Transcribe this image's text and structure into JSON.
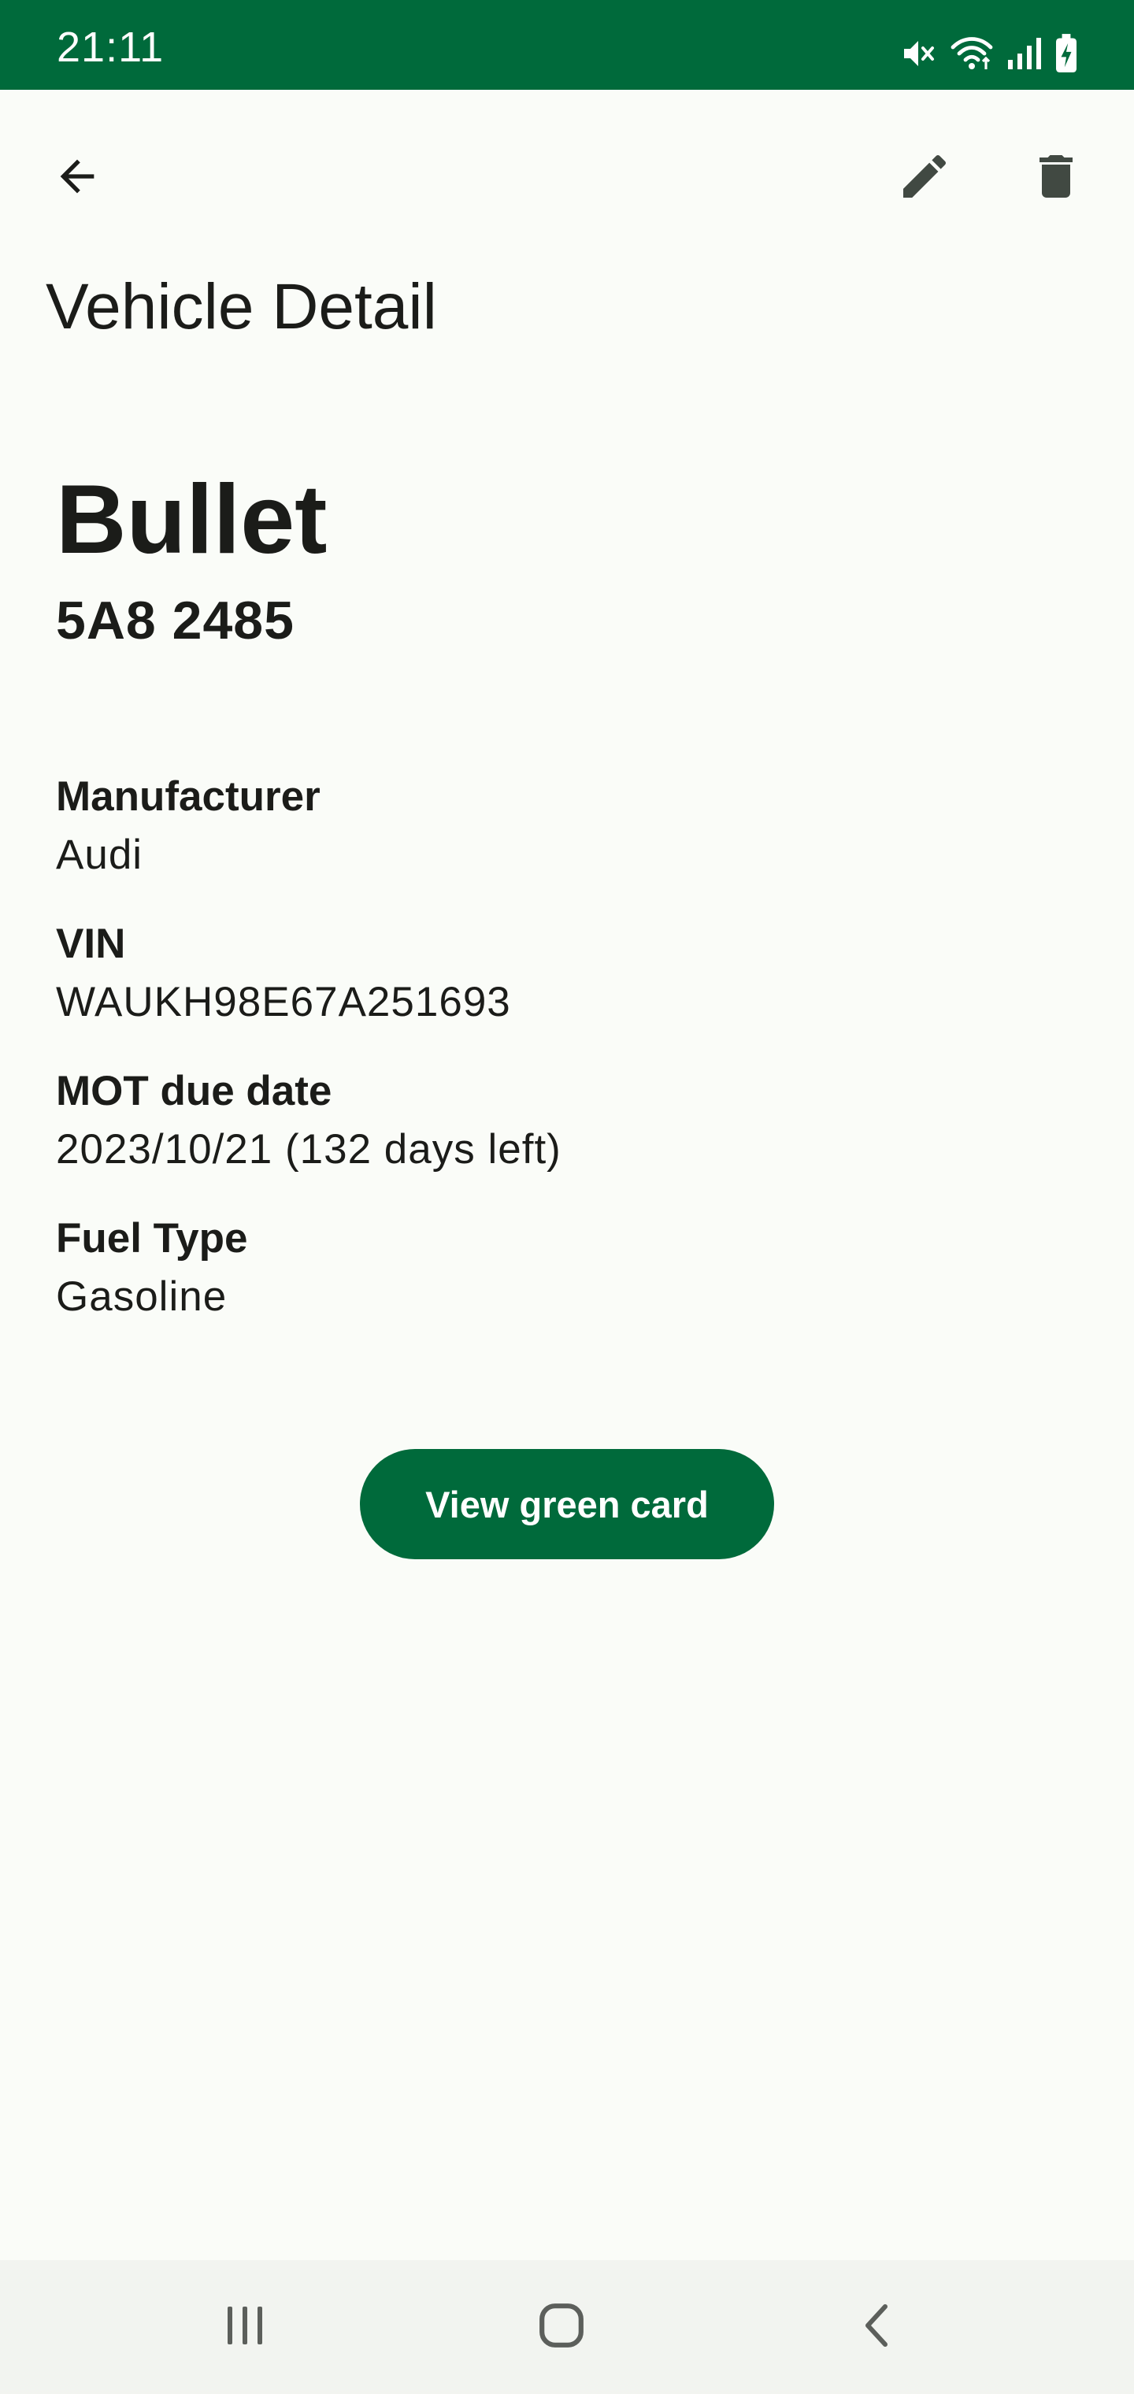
{
  "status_bar": {
    "time": "21:11",
    "icons": [
      "mute-icon",
      "wifi-icon",
      "signal-icon",
      "battery-charging-icon"
    ]
  },
  "app_bar": {
    "title": "Vehicle Detail",
    "actions": [
      "back-arrow-icon",
      "edit-pencil-icon",
      "delete-trash-icon"
    ]
  },
  "vehicle": {
    "name": "Bullet",
    "plate": "5A8 2485"
  },
  "details": [
    {
      "label": "Manufacturer",
      "value": "Audi"
    },
    {
      "label": "VIN",
      "value": "WAUKH98E67A251693"
    },
    {
      "label": "MOT due date",
      "value": "2023/10/21 (132 days left)"
    },
    {
      "label": "Fuel Type",
      "value": "Gasoline"
    }
  ],
  "actions": {
    "green_card_label": "View green card"
  },
  "nav_bar": {
    "buttons": [
      "recents-icon",
      "home-icon",
      "back-chevron-icon"
    ]
  },
  "colors": {
    "primary": "#006a3b",
    "background": "#fafcf8",
    "text": "#1b1c19",
    "nav_background": "#f2f4f0"
  }
}
